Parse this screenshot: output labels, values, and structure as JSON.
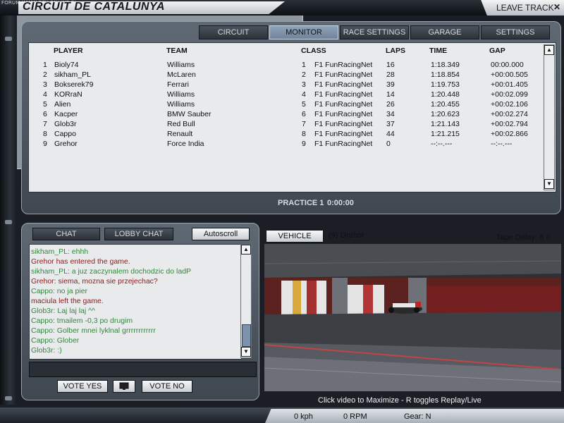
{
  "watermark": "FORUM WWW.GRY-ONLINE.PL",
  "track_title": "CIRCUIT DE CATALUNYA",
  "leave_track": "LEAVE TRACK",
  "close_glyph": "✕",
  "tabs": [
    {
      "label": "CIRCUIT",
      "active": false
    },
    {
      "label": "MONITOR",
      "active": true
    },
    {
      "label": "RACE SETTINGS",
      "active": false
    },
    {
      "label": "GARAGE",
      "active": false
    },
    {
      "label": "SETTINGS",
      "active": false
    }
  ],
  "standings": {
    "headers": {
      "player": "PLAYER",
      "team": "TEAM",
      "class": "CLASS",
      "laps": "LAPS",
      "time": "TIME",
      "gap": "GAP"
    },
    "rows": [
      {
        "pos": "1",
        "player": "Bioly74",
        "team": "Williams",
        "cpos": "1",
        "class": "F1 FunRacingNet",
        "laps": "16",
        "time": "1:18.349",
        "gap": "00:00.000"
      },
      {
        "pos": "2",
        "player": "sikham_PL",
        "team": "McLaren",
        "cpos": "2",
        "class": "F1 FunRacingNet",
        "laps": "28",
        "time": "1:18.854",
        "gap": "+00:00.505"
      },
      {
        "pos": "3",
        "player": "Bokserek79",
        "team": "Ferrari",
        "cpos": "3",
        "class": "F1 FunRacingNet",
        "laps": "39",
        "time": "1:19.753",
        "gap": "+00:01.405"
      },
      {
        "pos": "4",
        "player": "KORraN",
        "team": "Williams",
        "cpos": "4",
        "class": "F1 FunRacingNet",
        "laps": "14",
        "time": "1:20.448",
        "gap": "+00:02.099"
      },
      {
        "pos": "5",
        "player": "Alien",
        "team": "Williams",
        "cpos": "5",
        "class": "F1 FunRacingNet",
        "laps": "26",
        "time": "1:20.455",
        "gap": "+00:02.106"
      },
      {
        "pos": "6",
        "player": "Kacper",
        "team": "BMW Sauber",
        "cpos": "6",
        "class": "F1 FunRacingNet",
        "laps": "34",
        "time": "1:20.623",
        "gap": "+00:02.274"
      },
      {
        "pos": "7",
        "player": "Glob3r",
        "team": "Red Bull",
        "cpos": "7",
        "class": "F1 FunRacingNet",
        "laps": "37",
        "time": "1:21.143",
        "gap": "+00:02.794"
      },
      {
        "pos": "8",
        "player": "Cappo",
        "team": "Renault",
        "cpos": "8",
        "class": "F1 FunRacingNet",
        "laps": "44",
        "time": "1:21.215",
        "gap": "+00:02.866"
      },
      {
        "pos": "9",
        "player": "Grehor",
        "team": "Force India",
        "cpos": "9",
        "class": "F1 FunRacingNet",
        "laps": "0",
        "time": "--:--.---",
        "gap": "--:--.---"
      }
    ]
  },
  "session": {
    "label": "PRACTICE 1",
    "time": "0:00:00"
  },
  "chat": {
    "tab_chat": "CHAT",
    "tab_lobby": "LOBBY CHAT",
    "autoscroll": "Autoscroll",
    "lines": [
      {
        "text": "sikham_PL: ehhh",
        "color": "#2f8a3a"
      },
      {
        "text": "Grehor has entered the game.",
        "color": "#8a1c1c"
      },
      {
        "text": "sikham_PL: a juz zaczynalem dochodzic do ladP",
        "color": "#2f8a3a"
      },
      {
        "text": "Grehor: siema, mozna sie przejechac?",
        "color": "#8a1c1c"
      },
      {
        "text": "Cappo: no ja pier",
        "color": "#2f8a3a"
      },
      {
        "text": "maciula left the game.",
        "color": "#8a1c1c"
      },
      {
        "text": "Glob3r: Laj laj laj ^^",
        "color": "#2f8a3a"
      },
      {
        "text": "Cappo: tmailem -0,3 po drugim",
        "color": "#2f8a3a"
      },
      {
        "text": "Cappo: Golber mnei lyklnal grrrrrrrrrrrr",
        "color": "#2f8a3a"
      },
      {
        "text": "Cappo: Glober",
        "color": "#2f8a3a"
      },
      {
        "text": "Glob3r: :)",
        "color": "#2f8a3a"
      }
    ],
    "input_value": "",
    "vote_yes": "VOTE YES",
    "vote_no": "VOTE NO"
  },
  "video": {
    "vehicle_button": "VEHICLE",
    "driver": "(9) Grehor",
    "tape_delay": "Tape Delay: 8 s",
    "hint": "Click video to Maximize  -  R toggles Replay/Live"
  },
  "telemetry": {
    "speed": "0 kph",
    "rpm": "0 RPM",
    "gear": "Gear: N"
  },
  "colors": {
    "accent_tab": "#7f94aa",
    "panel": "#4f5862",
    "list_bg": "#e8eaec"
  }
}
